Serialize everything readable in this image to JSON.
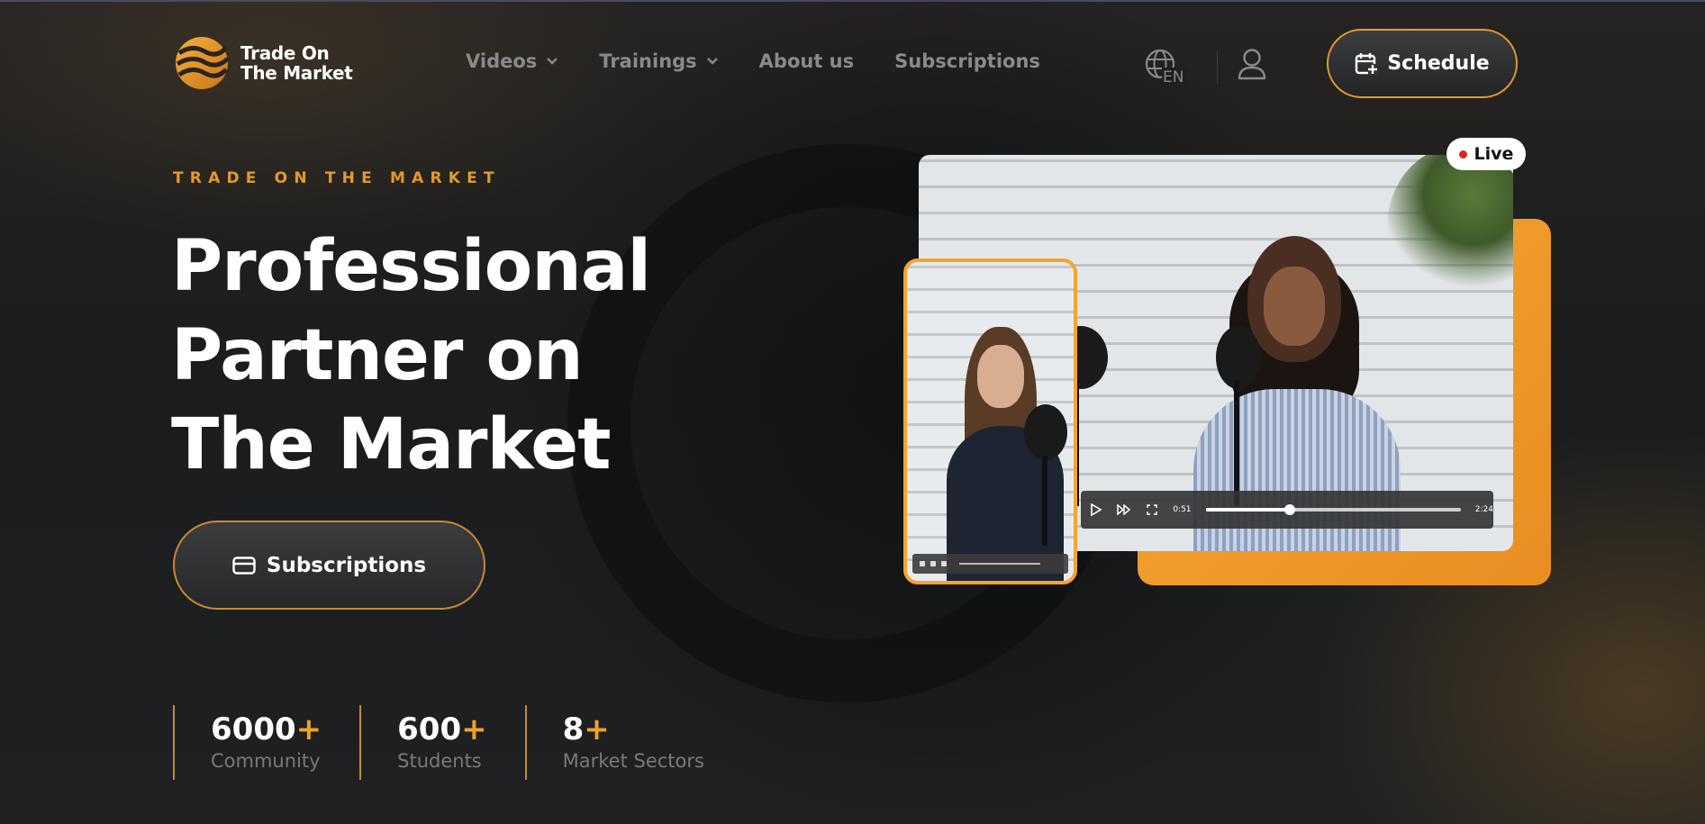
{
  "brand": {
    "name_line1": "Trade On",
    "name_line2": "The Market"
  },
  "nav": {
    "items": [
      {
        "label": "Videos",
        "has_dropdown": true
      },
      {
        "label": "Trainings",
        "has_dropdown": true
      },
      {
        "label": "About us",
        "has_dropdown": false
      },
      {
        "label": "Subscriptions",
        "has_dropdown": false
      }
    ],
    "language": "EN",
    "schedule_label": "Schedule"
  },
  "hero": {
    "eyebrow": "TRADE ON THE MARKET",
    "headline_line1": "Professional",
    "headline_line2": "Partner on",
    "headline_line3": "The Market",
    "cta_label": "Subscriptions"
  },
  "stats": [
    {
      "number": "6000",
      "plus": "+",
      "label": "Community"
    },
    {
      "number": "600",
      "plus": "+",
      "label": "Students"
    },
    {
      "number": "8",
      "plus": "+",
      "label": "Market Sectors"
    }
  ],
  "media": {
    "live_label": "Live",
    "main_player": {
      "time_current": "0:51",
      "time_total": "2:24",
      "progress": 0.33
    }
  },
  "colors": {
    "accent": "#f0a12c",
    "background": "#1c1d1e",
    "muted_text": "#8a8a8a",
    "live_dot": "#d8281e"
  }
}
